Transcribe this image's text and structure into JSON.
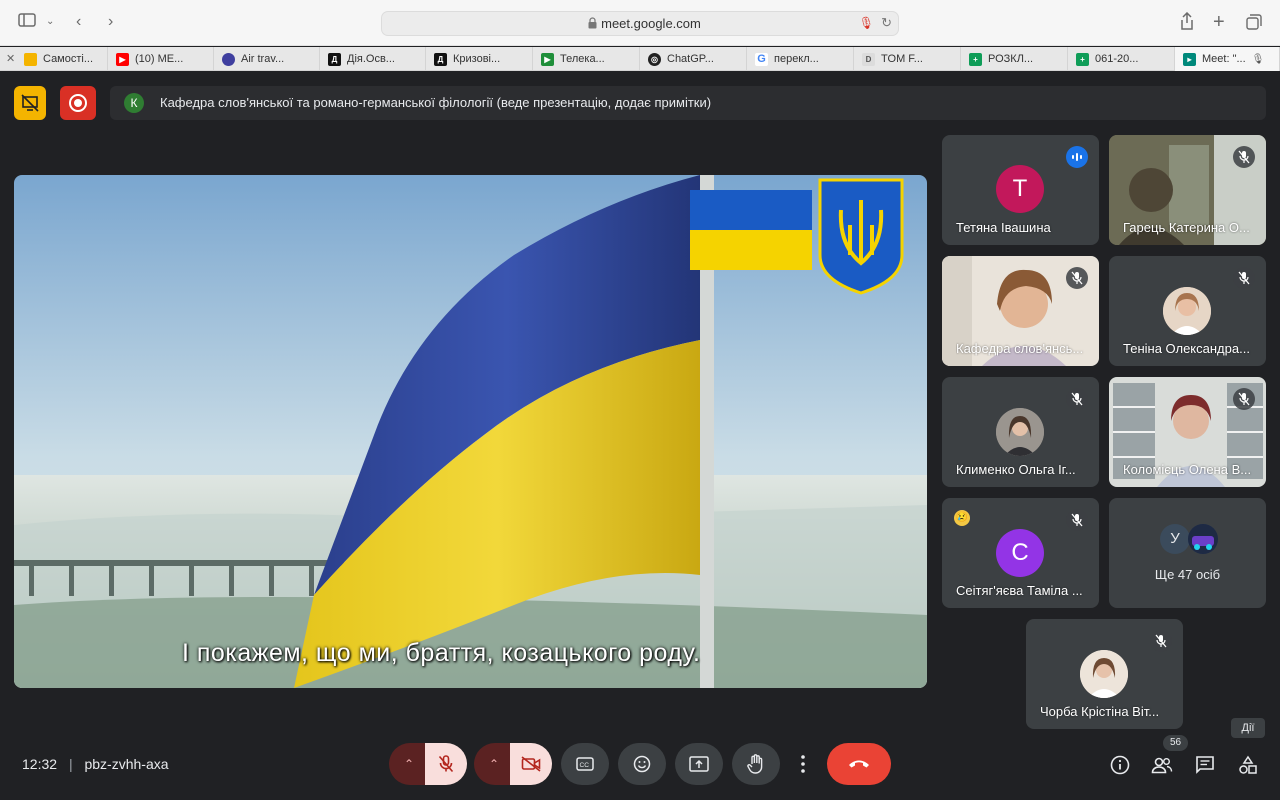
{
  "browser": {
    "url": "meet.google.com",
    "tabs": [
      {
        "label": "Самості...",
        "icon": "classroom-icon",
        "color": "#f4b400"
      },
      {
        "label": "(10) ME...",
        "icon": "youtube-icon",
        "color": "#ff0000"
      },
      {
        "label": "Air trav...",
        "icon": "app-icon",
        "color": "#3f3f9f"
      },
      {
        "label": "Дія.Осв...",
        "icon": "diia-icon",
        "color": "#111111"
      },
      {
        "label": "Кризові...",
        "icon": "diia-icon",
        "color": "#111111"
      },
      {
        "label": "Телека...",
        "icon": "play-icon",
        "color": "#1f8f3a"
      },
      {
        "label": "ChatGP...",
        "icon": "chatgpt-icon",
        "color": "#222222"
      },
      {
        "label": "перекл...",
        "icon": "google-icon",
        "color": "#4285f4"
      },
      {
        "label": "TOM F...",
        "icon": "doc-icon",
        "color": "#7f7f7f"
      },
      {
        "label": "РОЗКЛ...",
        "icon": "sheets-icon",
        "color": "#0f9d58"
      },
      {
        "label": "061-20...",
        "icon": "sheets-icon",
        "color": "#0f9d58"
      },
      {
        "label": "Meet: \"...",
        "icon": "meet-icon",
        "color": "#00897b"
      }
    ]
  },
  "meet": {
    "presenter_initial": "К",
    "presenter_text": "Кафедра слов'янської та романо-германської філології (веде презентацію, додає примітки)",
    "caption": "І покажем, що ми, браття, козацького роду.",
    "participants": [
      {
        "name": "Тетяна Івашина",
        "initial": "T",
        "color": "#c2185b",
        "status": "speaking"
      },
      {
        "name": "Гарець Катерина О...",
        "status": "muted"
      },
      {
        "name": "Кафедра слов'янсь...",
        "status": "muted"
      },
      {
        "name": "Теніна Олександра...",
        "status": "muted"
      },
      {
        "name": "Клименко Ольга Іг...",
        "status": "muted"
      },
      {
        "name": "Коломієць Олена В...",
        "status": "muted"
      },
      {
        "name": "Сеітяг'яєва Таміла ...",
        "initial": "C",
        "color": "#9334e6",
        "status": "muted",
        "emoji": "😢"
      },
      {
        "name": "Чорба Крістіна Віт...",
        "status": "muted"
      }
    ],
    "others": {
      "initial": "У",
      "label": "Ще 47 осіб"
    },
    "time": "12:32",
    "meeting_code": "pbz-zvhh-axa",
    "participant_count": "56",
    "actions_label": "Дії",
    "colors": {
      "end_call": "#ea4335",
      "muted_bg": "#f9dedc",
      "accent": "#1a73e8"
    }
  }
}
